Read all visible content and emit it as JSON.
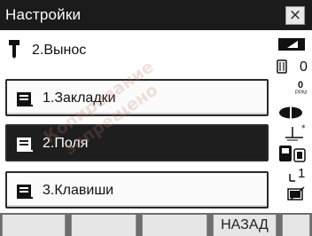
{
  "window": {
    "title": "Настройки",
    "close_label": "×"
  },
  "header": {
    "label": "2.Вынос",
    "icon": "stakeout-pole-icon"
  },
  "menu": {
    "items": [
      {
        "label": "1.Закладки",
        "icon": "memo-icon",
        "selected": false
      },
      {
        "label": "2.Поля",
        "icon": "memo-icon",
        "selected": true
      },
      {
        "label": "3.Клавиши",
        "icon": "memo-icon",
        "selected": false
      }
    ]
  },
  "status": {
    "signal_icon": "signal-strength-icon",
    "prism_constant": "0",
    "ppm_value": "0",
    "ppm_unit": "PPM",
    "target_icon": "target-type-icon",
    "laser_icon": "laser-plummet-icon",
    "compensator_icon": "tilt-compensator-icon",
    "input_mode": "1",
    "battery_icon": "battery-icon"
  },
  "softkeys": [
    "",
    "",
    "",
    "НАЗАД",
    ""
  ],
  "watermark": {
    "line1": "Копирование",
    "line2": "запрещено"
  },
  "colors": {
    "titlebar": "#1b1b1b",
    "selected": "#1e1e1e",
    "softkey_bar": "#6e6e6e"
  }
}
